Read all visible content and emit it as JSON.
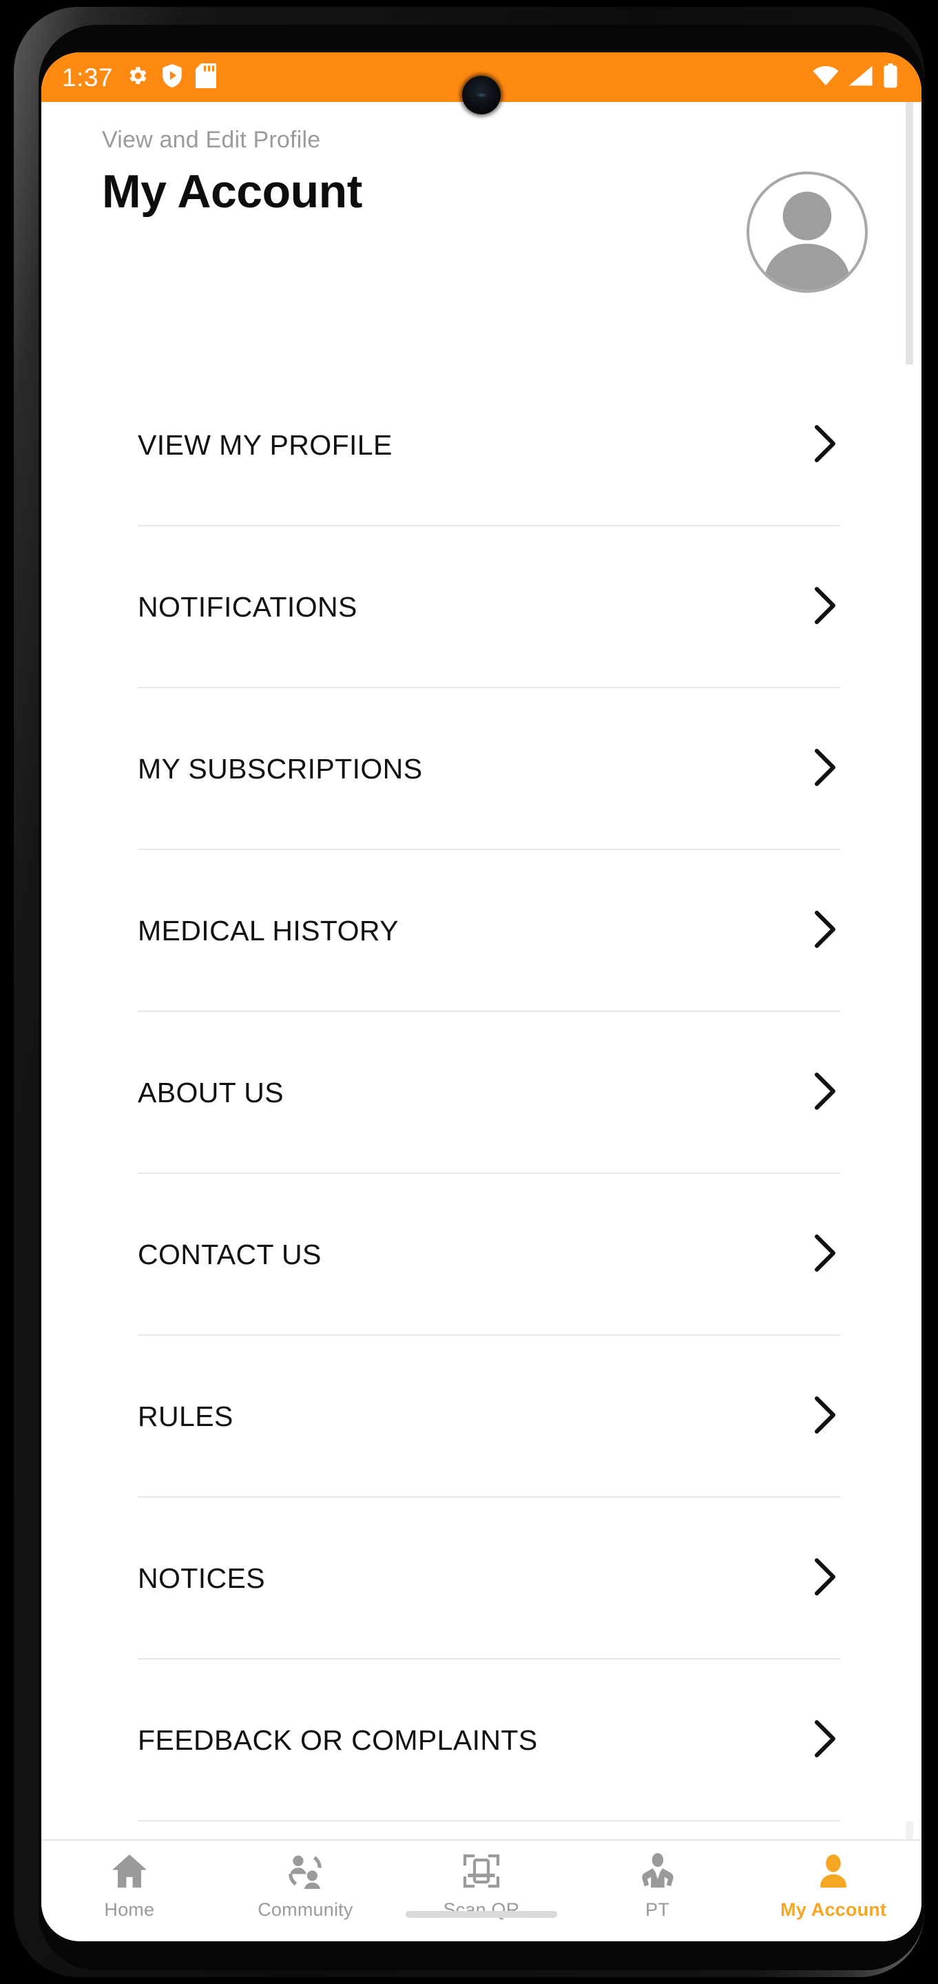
{
  "status_bar": {
    "time": "1:37",
    "left_icons": [
      "gear-icon",
      "shield-play-icon",
      "sd-card-icon"
    ],
    "right_icons": [
      "wifi-icon",
      "cellular-signal-icon",
      "battery-icon"
    ],
    "background_color": "#FF8A12"
  },
  "header": {
    "subtitle": "View and Edit Profile",
    "title": "My Account",
    "avatar_alt": "profile-avatar-placeholder"
  },
  "menu": {
    "items": [
      {
        "label": "VIEW MY PROFILE"
      },
      {
        "label": "NOTIFICATIONS"
      },
      {
        "label": "MY SUBSCRIPTIONS"
      },
      {
        "label": "MEDICAL HISTORY"
      },
      {
        "label": "ABOUT US"
      },
      {
        "label": "CONTACT US"
      },
      {
        "label": "RULES"
      },
      {
        "label": "NOTICES"
      },
      {
        "label": "FEEDBACK OR COMPLAINTS"
      }
    ]
  },
  "bottom_nav": {
    "active_color": "#F5A623",
    "inactive_color": "#9a9a9a",
    "items": [
      {
        "label": "Home",
        "icon": "home-icon",
        "active": false
      },
      {
        "label": "Community",
        "icon": "community-icon",
        "active": false
      },
      {
        "label": "Scan QR",
        "icon": "scan-qr-icon",
        "active": false
      },
      {
        "label": "PT",
        "icon": "personal-trainer-icon",
        "active": false
      },
      {
        "label": "My Account",
        "icon": "account-person-icon",
        "active": true
      }
    ]
  }
}
